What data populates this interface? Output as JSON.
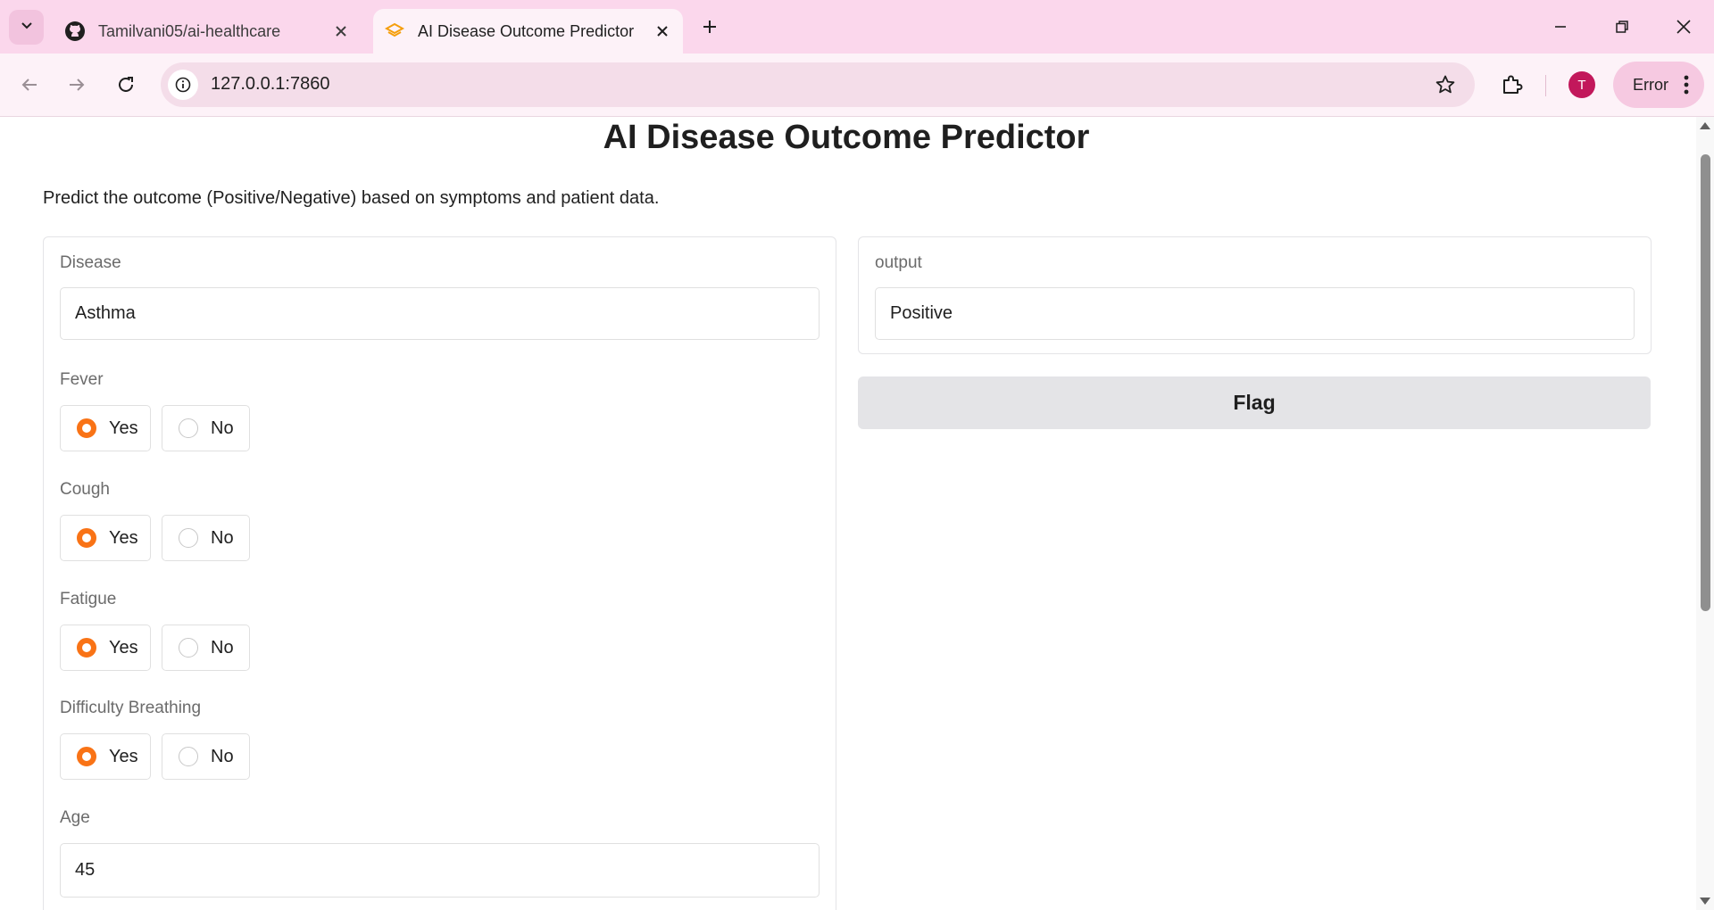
{
  "browser": {
    "tabs": [
      {
        "title": "Tamilvani05/ai-healthcare",
        "active": false
      },
      {
        "title": "AI Disease Outcome Predictor",
        "active": true
      }
    ],
    "url": "127.0.0.1:7860",
    "profile_initial": "T",
    "error_label": "Error",
    "accent_color": "#fbd7ec"
  },
  "app": {
    "title": "AI Disease Outcome Predictor",
    "description": "Predict the outcome (Positive/Negative) based on symptoms and patient data.",
    "inputs": {
      "disease": {
        "label": "Disease",
        "value": "Asthma"
      },
      "fever": {
        "label": "Fever",
        "options": [
          "Yes",
          "No"
        ],
        "selected": "Yes"
      },
      "cough": {
        "label": "Cough",
        "options": [
          "Yes",
          "No"
        ],
        "selected": "Yes"
      },
      "fatigue": {
        "label": "Fatigue",
        "options": [
          "Yes",
          "No"
        ],
        "selected": "Yes"
      },
      "difficulty_breathing": {
        "label": "Difficulty Breathing",
        "options": [
          "Yes",
          "No"
        ],
        "selected": "Yes"
      },
      "age": {
        "label": "Age",
        "value": "45"
      }
    },
    "output": {
      "label": "output",
      "value": "Positive"
    },
    "flag_label": "Flag",
    "accent_color": "#f97316"
  }
}
